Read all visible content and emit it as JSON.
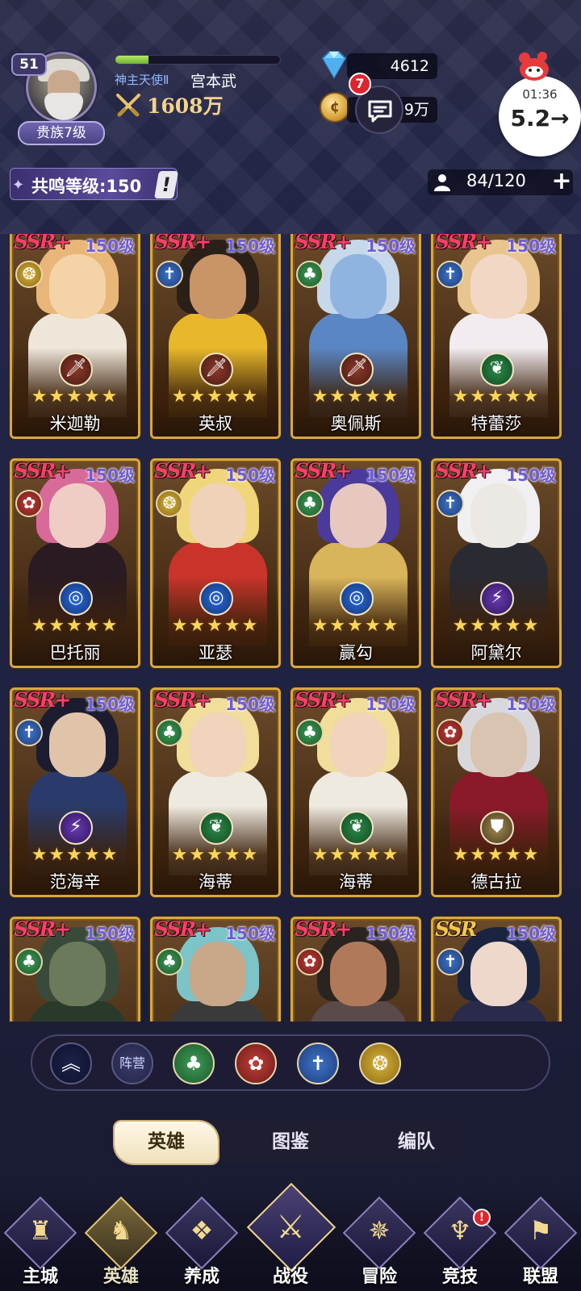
{
  "player": {
    "level": "51",
    "noble": "贵族7级",
    "rank_title": "神主天使Ⅱ",
    "name": "宫本武",
    "power": "1608万",
    "exp_progress": 0.2
  },
  "resources": {
    "gems": "4612",
    "gold": "9万",
    "chat_unread": "7"
  },
  "timer": {
    "time": "01:36",
    "value": "5.2→"
  },
  "resonance": {
    "label": "共鸣等级:150",
    "warn": "!"
  },
  "hero_count": {
    "text": "84/120",
    "add": "+"
  },
  "heroes": [
    {
      "rarity": "SSR+",
      "level": "150级",
      "name": "米迦勒",
      "faction": "dawn",
      "class": "warrior"
    },
    {
      "rarity": "SSR+",
      "level": "150级",
      "name": "英叔",
      "faction": "holy",
      "class": "warrior"
    },
    {
      "rarity": "SSR+",
      "level": "150级",
      "name": "奥佩斯",
      "faction": "nature",
      "class": "warrior"
    },
    {
      "rarity": "SSR+",
      "level": "150级",
      "name": "特蕾莎",
      "faction": "holy",
      "class": "support"
    },
    {
      "rarity": "SSR+",
      "level": "150级",
      "name": "巴托丽",
      "faction": "rose",
      "class": "mage"
    },
    {
      "rarity": "SSR+",
      "level": "150级",
      "name": "亚瑟",
      "faction": "dawn",
      "class": "mage"
    },
    {
      "rarity": "SSR+",
      "level": "150级",
      "name": "赢勾",
      "faction": "nature",
      "class": "mage"
    },
    {
      "rarity": "SSR+",
      "level": "150级",
      "name": "阿黛尔",
      "faction": "holy",
      "class": "assassin"
    },
    {
      "rarity": "SSR+",
      "level": "150级",
      "name": "范海辛",
      "faction": "holy",
      "class": "assassin"
    },
    {
      "rarity": "SSR+",
      "level": "150级",
      "name": "海蒂",
      "faction": "nature",
      "class": "support"
    },
    {
      "rarity": "SSR+",
      "level": "150级",
      "name": "海蒂",
      "faction": "nature",
      "class": "support"
    },
    {
      "rarity": "SSR+",
      "level": "150级",
      "name": "德古拉",
      "faction": "rose",
      "class": "tank"
    },
    {
      "rarity": "SSR+",
      "level": "150级",
      "name": "",
      "faction": "nature",
      "class": ""
    },
    {
      "rarity": "SSR+",
      "level": "150级",
      "name": "",
      "faction": "nature",
      "class": ""
    },
    {
      "rarity": "SSR+",
      "level": "150级",
      "name": "",
      "faction": "rose",
      "class": ""
    },
    {
      "rarity": "SSR",
      "level": "150级",
      "name": "",
      "faction": "holy",
      "class": ""
    }
  ],
  "filter": {
    "collapse_icon": "chevron-up-icon",
    "camp_label": "阵营",
    "factions": [
      "nature",
      "rose",
      "holy",
      "dawn"
    ]
  },
  "tabs": [
    "英雄",
    "图鉴",
    "编队"
  ],
  "active_tab": 0,
  "nav": [
    "主城",
    "英雄",
    "养成",
    "战役",
    "冒险",
    "竞技",
    "联盟"
  ],
  "active_nav": 1,
  "nav_badge": "!",
  "colors": {
    "card_border": "#d8a83f",
    "level_text": "#6f5bd8",
    "star": "#ffd65a",
    "badge_red": "#e0242e"
  }
}
